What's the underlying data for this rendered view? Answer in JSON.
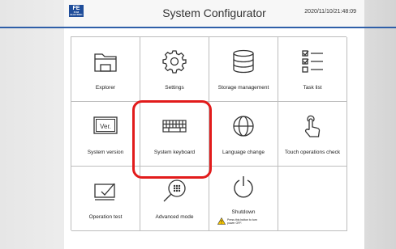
{
  "header": {
    "logo_text": "FE",
    "logo_subtext": "FUJI ELECTRIC",
    "title": "System Configurator",
    "datetime": "2020/11/10/21:48:09"
  },
  "tiles": [
    {
      "label": "Explorer",
      "icon": "folder-icon"
    },
    {
      "label": "Settings",
      "icon": "gear-icon"
    },
    {
      "label": "Storage management",
      "icon": "database-icon"
    },
    {
      "label": "Task list",
      "icon": "checklist-icon"
    },
    {
      "label": "System version",
      "icon": "version-icon",
      "icon_text": "Ver."
    },
    {
      "label": "System keyboard",
      "icon": "keyboard-icon"
    },
    {
      "label": "Language change",
      "icon": "globe-icon"
    },
    {
      "label": "Touch operations check",
      "icon": "touch-hand-icon"
    },
    {
      "label": "Operation test",
      "icon": "monitor-check-icon"
    },
    {
      "label": "Advanced mode",
      "icon": "magnifier-icon"
    },
    {
      "label": "Shutdown",
      "icon": "power-icon",
      "note": "Press this button to turn power OFF."
    }
  ],
  "highlight": {
    "color": "#e21b1b",
    "target": "System keyboard"
  }
}
